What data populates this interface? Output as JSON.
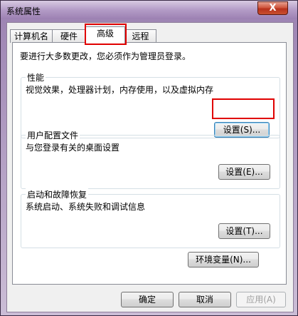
{
  "window": {
    "title": "系统属性",
    "close_label": "X"
  },
  "tabs": [
    {
      "label": "计算机名"
    },
    {
      "label": "硬件"
    },
    {
      "label": "高级"
    },
    {
      "label": "远程"
    }
  ],
  "advanced": {
    "admin_note": "要进行大多数更改，您必须作为管理员登录。",
    "performance": {
      "title": "性能",
      "description": "视觉效果，处理器计划，内存使用，以及虚拟内存",
      "settings_label": "设置(S)..."
    },
    "user_profiles": {
      "title": "用户配置文件",
      "description": "与您登录有关的桌面设置",
      "settings_label": "设置(E)..."
    },
    "startup_recovery": {
      "title": "启动和故障恢复",
      "description": "系统启动、系统失败和调试信息",
      "settings_label": "设置(T)..."
    },
    "env_vars_label": "环境变量(N)..."
  },
  "footer": {
    "ok_label": "确定",
    "cancel_label": "取消",
    "apply_label": "应用(A)"
  },
  "colors": {
    "highlight": "#e00000",
    "title_bar": "#b39bc6"
  }
}
